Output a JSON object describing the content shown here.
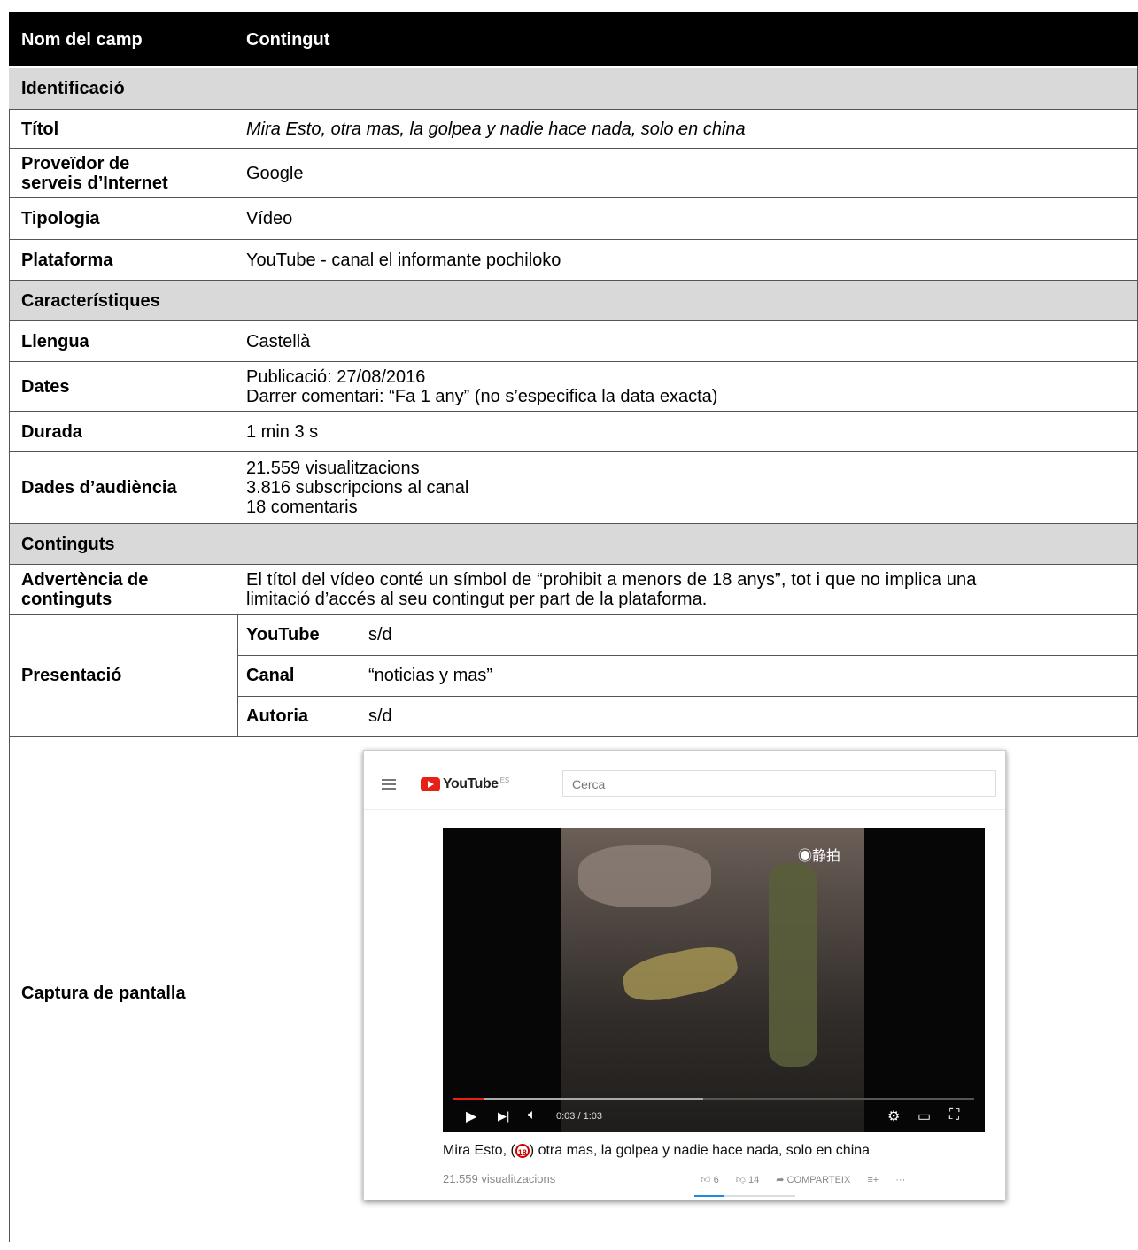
{
  "header": {
    "col1": "Nom del camp",
    "col2": "Contingut"
  },
  "sections": {
    "identificacio": "Identificació",
    "caracteristiques": "Característiques",
    "continguts": "Continguts"
  },
  "rows": {
    "titol": {
      "label": "Títol",
      "value": "Mira Esto, otra mas, la golpea y nadie hace nada, solo en china"
    },
    "proveidor": {
      "label1": "Proveïdor de",
      "label2": "serveis d’Internet",
      "value": "Google"
    },
    "tipologia": {
      "label": "Tipologia",
      "value": "Vídeo"
    },
    "plataforma": {
      "label": "Plataforma",
      "value": "YouTube - canal el informante pochiloko"
    },
    "llengua": {
      "label": "Llengua",
      "value": "Castellà"
    },
    "dates": {
      "label": "Dates",
      "line1": "Publicació: 27/08/2016",
      "line2": "Darrer comentari: “Fa 1 any” (no s’especifica la data exacta)"
    },
    "durada": {
      "label": "Durada",
      "value": "1 min 3 s"
    },
    "audiencia": {
      "label": "Dades d’audiència",
      "line1": "21.559 visualitzacions",
      "line2": "3.816 subscripcions al canal",
      "line3": "18 comentaris"
    },
    "advertencia": {
      "label1": "Advertència de",
      "label2": "continguts",
      "line1": "El títol del vídeo conté un símbol de “prohibit a menors de 18 anys”, tot i que no implica una",
      "line2": "limitació d’accés al seu contingut per part de la plataforma."
    },
    "presentacio": {
      "label": "Presentació",
      "sub": [
        {
          "key": "YouTube",
          "value": "s/d"
        },
        {
          "key": "Canal",
          "value": "“noticias y mas”"
        },
        {
          "key": "Autoria",
          "value": "s/d"
        }
      ]
    },
    "captura": {
      "label": "Captura de pantalla"
    }
  },
  "screenshot": {
    "logo_text": "YouTube",
    "logo_sup": "ES",
    "search_placeholder": "Cerca",
    "watermark": "◉静拍",
    "time": "0:03 / 1:03",
    "title_before": "Mira Esto, (",
    "age_badge": "18",
    "title_after": ") otra mas, la golpea y nadie hace nada, solo en china",
    "views": "21.559 visualitzacions",
    "likes": "6",
    "dislikes": "14",
    "share": "COMPARTEIX",
    "progress_played": 0.06,
    "progress_buffered": 0.48,
    "icons": [
      "menu-icon",
      "play-icon",
      "next-icon",
      "volume-icon",
      "settings-icon",
      "theater-icon",
      "fullscreen-icon",
      "thumbs-up-icon",
      "thumbs-down-icon",
      "share-icon",
      "add-to-playlist-icon",
      "more-icon"
    ]
  }
}
